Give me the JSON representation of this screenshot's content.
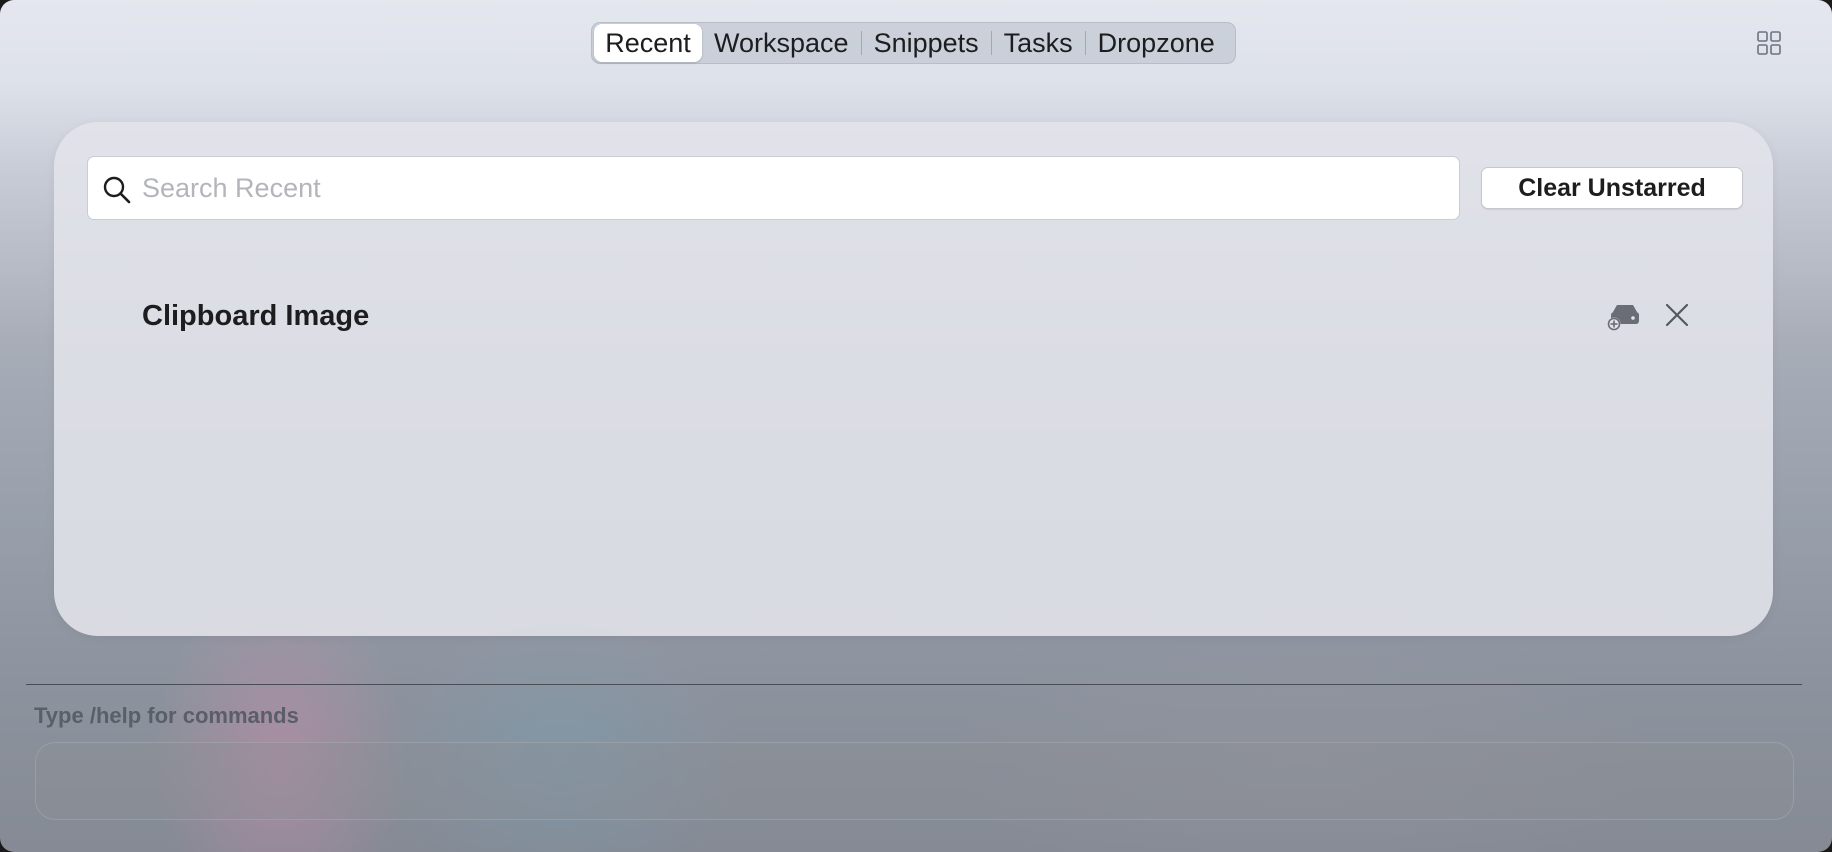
{
  "tabs": [
    {
      "label": "Recent",
      "active": true
    },
    {
      "label": "Workspace",
      "active": false
    },
    {
      "label": "Snippets",
      "active": false
    },
    {
      "label": "Tasks",
      "active": false
    },
    {
      "label": "Dropzone",
      "active": false
    }
  ],
  "toolbar": {
    "grid_icon": "grid-icon"
  },
  "search": {
    "placeholder": "Search Recent",
    "value": "",
    "icon": "search-icon"
  },
  "clear_button": {
    "label": "Clear Unstarred"
  },
  "items": [
    {
      "title": "Clipboard Image",
      "action_icon": "add-to-drive-icon",
      "close_icon": "close-icon"
    }
  ],
  "command_bar": {
    "hint": "Type /help for commands",
    "value": ""
  },
  "colors": {
    "text": "#1d1d1f",
    "placeholder": "#b3b5ba",
    "hint": "#5a5e66",
    "panel_bg": "#e2e4ea"
  }
}
